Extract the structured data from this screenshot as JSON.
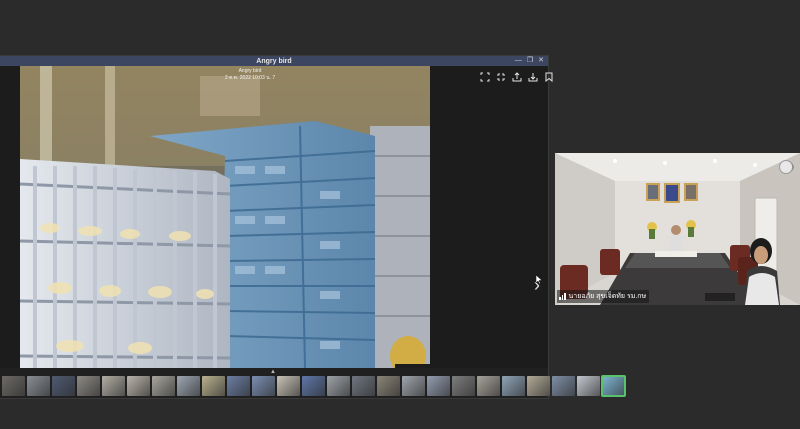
{
  "viewer": {
    "title": "Angry bird",
    "caption_title": "Angry bird",
    "caption_subtitle": "3 ต.ค. 2022 10:03 น. 7",
    "window_controls": [
      "—",
      "❐",
      "✕"
    ],
    "toolbar_icons": [
      "fullscreen-icon",
      "collapse-icon",
      "share-icon",
      "download-icon",
      "bookmark-icon"
    ],
    "next_label": "›"
  },
  "filmstrip": {
    "expander_label": "▲",
    "thumb_colors": [
      "#6d6a66",
      "#8a8f95",
      "#4f5a72",
      "#8d8a84",
      "#b2aea4",
      "#b9b4aa",
      "#a8a69e",
      "#9fa7b4",
      "#b9b18f",
      "#6b7ea3",
      "#7a8fb2",
      "#c8c2b6",
      "#5e76a8",
      "#9ea3aa",
      "#707680",
      "#8b8578",
      "#a0a6ad",
      "#939db0",
      "#7d7d7d",
      "#a7a39b",
      "#8fa4b8",
      "#b2aa97",
      "#7e8fa6",
      "#c3c8cf",
      "#7fb7d4"
    ],
    "selected_index": 24
  },
  "participant": {
    "name": "นายอภัย สุขเจ็ดทัย รม.กษ"
  }
}
